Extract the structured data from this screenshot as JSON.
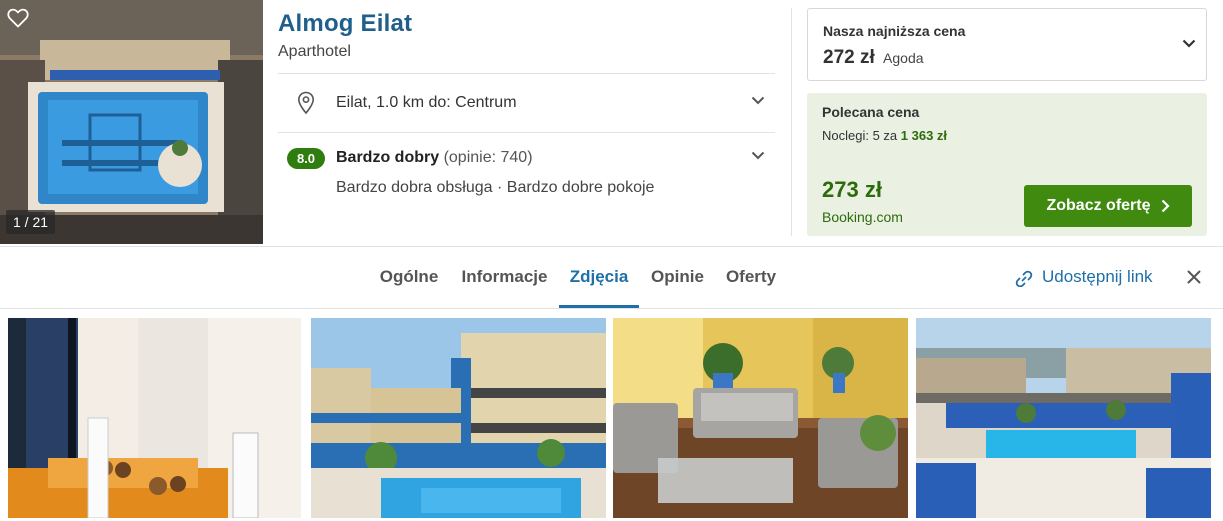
{
  "hero": {
    "photo_counter": "1 / 21",
    "icons": {
      "favorite": "heart-outline-icon"
    }
  },
  "hotel": {
    "name": "Almog Eilat",
    "type": "Aparthotel",
    "location": "Eilat, 1.0 km do: Centrum",
    "rating": {
      "score": "8.0",
      "word": "Bardzo dobry",
      "count": "(opinie: 740)",
      "highlights": "Bardzo dobra obsługa · Bardzo dobre pokoje"
    }
  },
  "pricing": {
    "best": {
      "label": "Nasza najniższa cena",
      "price": "272 zł",
      "provider": "Agoda"
    },
    "recommended": {
      "label": "Polecana cena",
      "nights_prefix": "Noclegi: 5 za",
      "nights_total": "1 363 zł",
      "price": "273 zł",
      "provider": "Booking.com",
      "button_label": "Zobacz ofertę"
    }
  },
  "tabs": [
    {
      "label": "Ogólne",
      "active": false
    },
    {
      "label": "Informacje",
      "active": false
    },
    {
      "label": "Zdjęcia",
      "active": true
    },
    {
      "label": "Opinie",
      "active": false
    },
    {
      "label": "Oferty",
      "active": false
    }
  ],
  "share_label": "Udostępnij link",
  "colors": {
    "brand_blue": "#1f6fa8",
    "rating_green": "#2e7d0e",
    "cta_green": "#3f8a0f",
    "recommended_bg": "#eaf1e3"
  },
  "gallery": {
    "photos": [
      "room-interior",
      "hotel-pool-courtyard",
      "rooftop-lounge",
      "rooftop-pool-view"
    ]
  }
}
